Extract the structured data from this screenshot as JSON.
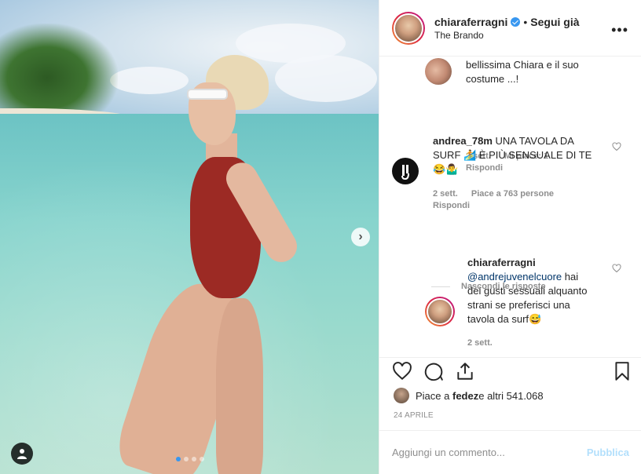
{
  "post": {
    "dots": 4,
    "active_dot": 1
  },
  "header": {
    "username": "chiaraferragni",
    "separator": "•",
    "follow_label": "Segui già",
    "location": "The Brando",
    "more_icon": "more-options-icon"
  },
  "comments": [
    {
      "text": "bellissima Chiara e il suo costume ...!",
      "time": "2 sett.",
      "likes": "Mi piace: 1",
      "reply": "Rispondi"
    },
    {
      "username": "andrea_78m",
      "text_line1": "UNA TAVOLA DA",
      "text_line2": "SURF 🏄 È PIÙ SENSUALE DI TE",
      "text_line3": "😂🤷‍♂️",
      "time": "2 sett.",
      "likes": "Piace a 763 persone",
      "reply": "Rispondi"
    },
    {
      "username": "chiaraferragni",
      "mention": "@andrejuvenelcuore",
      "text_line1": " hai",
      "text_line2": "dei gusti sessuali alquanto",
      "text_line3": "strani se preferisci una",
      "text_line4": "tavola da surf😅",
      "time": "2 sett."
    }
  ],
  "hide_replies_label": "Nascondi le risposte",
  "likes_text": "Piace a ",
  "likes_user": "fedez",
  "likes_others": " e altri 541.068",
  "date": "24 APRILE",
  "comment_placeholder": "Aggiungi un commento...",
  "publish_label": "Pubblica",
  "colors": {
    "accent": "#3897f0",
    "publish_disabled": "#b2dffc",
    "swimsuit": "#9c2a24"
  }
}
